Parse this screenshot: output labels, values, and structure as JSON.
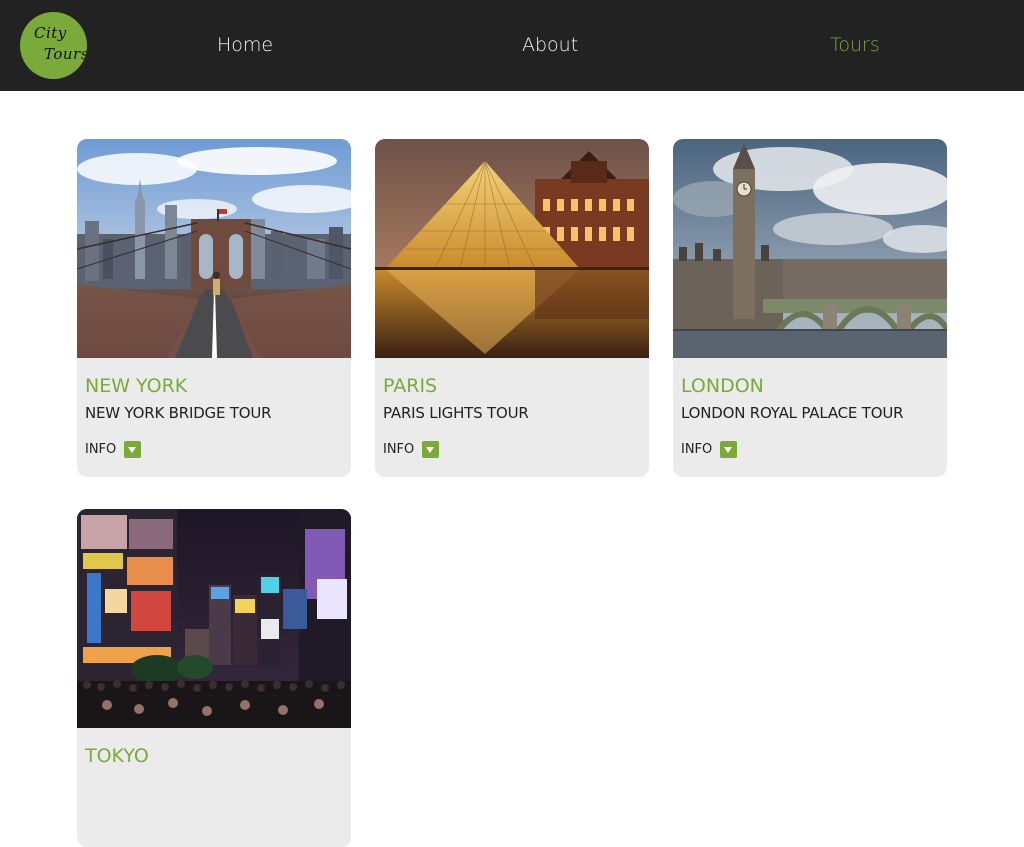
{
  "logo": {
    "line1": "City",
    "line2": "Tours"
  },
  "nav": {
    "home": "Home",
    "about": "About",
    "tours": "Tours",
    "active": "tours"
  },
  "colors": {
    "accent": "#7aaa3a",
    "header_bg": "#222222",
    "card_bg": "#ebebeb"
  },
  "tours": [
    {
      "city": "NEW YORK",
      "title": "NEW YORK BRIDGE TOUR",
      "info_label": "INFO",
      "photo_icon": "brooklyn-bridge-photo"
    },
    {
      "city": "PARIS",
      "title": "PARIS LIGHTS TOUR",
      "info_label": "INFO",
      "photo_icon": "louvre-pyramid-photo"
    },
    {
      "city": "LONDON",
      "title": "LONDON ROYAL PALACE TOUR",
      "info_label": "INFO",
      "photo_icon": "big-ben-photo"
    },
    {
      "city": "TOKYO",
      "title": "",
      "info_label": "",
      "photo_icon": "shibuya-night-photo"
    }
  ]
}
